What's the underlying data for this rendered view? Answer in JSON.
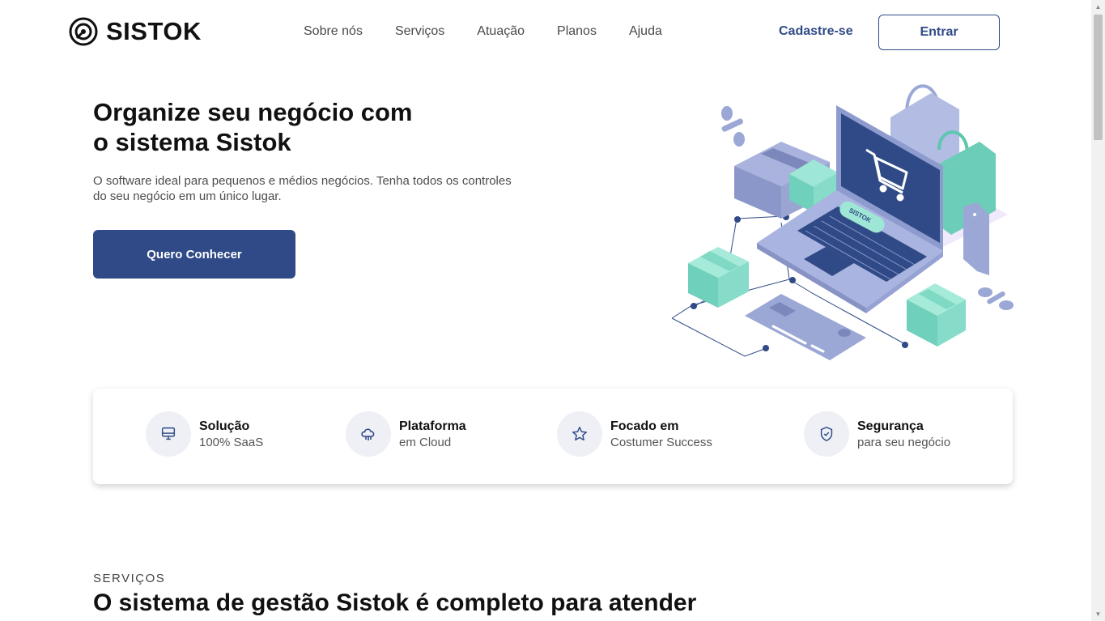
{
  "header": {
    "brand": "SISTOK",
    "nav": [
      "Sobre nós",
      "Serviços",
      "Atuação",
      "Planos",
      "Ajuda"
    ],
    "signup_label": "Cadastre-se",
    "login_label": "Entrar"
  },
  "hero": {
    "title_line1": "Organize seu negócio com",
    "title_line2": "o sistema Sistok",
    "subtitle": "O software ideal para pequenos e médios negócios. Tenha todos os controles do seu negócio em um único lugar.",
    "cta_label": "Quero Conhecer",
    "illustration_badge": "SISTOK"
  },
  "features": [
    {
      "icon": "monitor-icon",
      "title": "Solução",
      "subtitle": "100% SaaS"
    },
    {
      "icon": "cloud-icon",
      "title": "Plataforma",
      "subtitle": "em Cloud"
    },
    {
      "icon": "star-icon",
      "title": "Focado em",
      "subtitle": "Costumer Success"
    },
    {
      "icon": "shield-icon",
      "title": "Segurança",
      "subtitle": "para seu negócio"
    }
  ],
  "services": {
    "kicker": "SERVIÇOS",
    "title": "O sistema de gestão Sistok é completo para atender"
  },
  "colors": {
    "primary": "#2f4a86",
    "accent_green": "#7fd9c4",
    "lavender": "#9ba8d6",
    "icon_bg": "#eef0f6"
  }
}
